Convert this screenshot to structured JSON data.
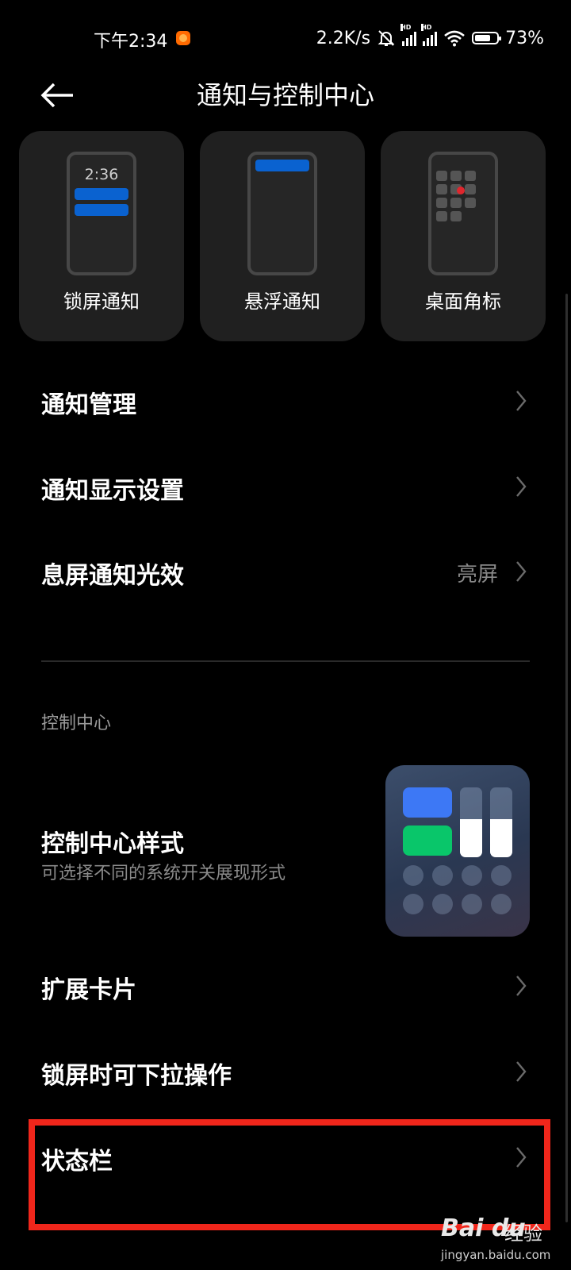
{
  "status_bar": {
    "time": "下午2:34",
    "net_speed": "2.2K/s",
    "hd_label": "HD",
    "battery": "73%",
    "battery_level": 0.73
  },
  "header": {
    "title": "通知与控制中心"
  },
  "cards": [
    {
      "label": "锁屏通知",
      "clock": "2:36"
    },
    {
      "label": "悬浮通知"
    },
    {
      "label": "桌面角标"
    }
  ],
  "rows": {
    "notification_management": "通知管理",
    "notification_display": "通知显示设置",
    "screen_off_light": "息屏通知光效",
    "screen_off_light_value": "亮屏"
  },
  "section_title": "控制中心",
  "control_center_style": {
    "title": "控制中心样式",
    "subtitle": "可选择不同的系统开关展现形式"
  },
  "rows2": {
    "expand_cards": "扩展卡片",
    "lockscreen_pulldown": "锁屏时可下拉操作",
    "status_bar": "状态栏"
  },
  "watermark": {
    "brand": "Bai du",
    "cn": "经验",
    "url": "jingyan.baidu.com"
  },
  "colors": {
    "highlight": "#f0261b",
    "accent_blue": "#0a62d0",
    "accent_green": "#09c66a"
  }
}
